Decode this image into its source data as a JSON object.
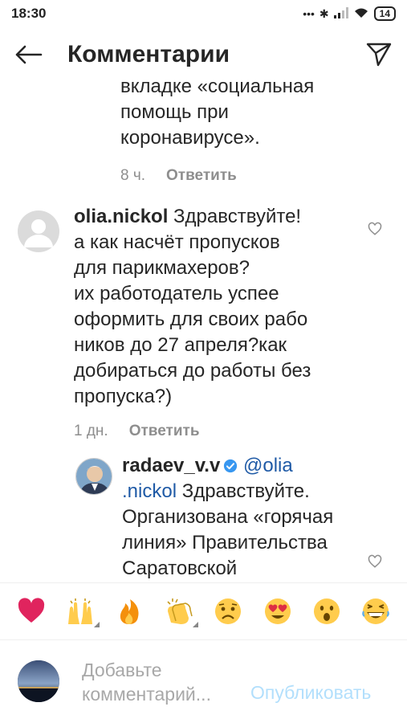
{
  "status_bar": {
    "time": "18:30",
    "battery": "14"
  },
  "header": {
    "title": "Комментарии"
  },
  "comments": {
    "prev": {
      "lines": [
        "вкладке «социальная",
        "помощь при",
        "коронавирусе»."
      ],
      "time": "8 ч.",
      "reply": "Ответить"
    },
    "c2": {
      "username": "olia.nickol",
      "lines": [
        "Здравствуйте!",
        "а как насчёт пропусков",
        "для парикмахеров?",
        "их работодатель успее",
        "оформить для своих рабо",
        "ников до 27 апреля?как",
        "добираться до работы без",
        "пропуска?)"
      ],
      "time": "1 дн.",
      "reply": "Ответить"
    },
    "c3": {
      "username": "radaev_v.v",
      "mention_part1": "@olia",
      "mention_part2": ".nickol",
      "lines": [
        "Здравствуйте.",
        "Организована «горячая",
        "линия» Правительства",
        "Саратовской"
      ]
    }
  },
  "emoji_bar": [
    "heart-emoji",
    "raised-hands-emoji",
    "fire-emoji",
    "clapping-hands-emoji",
    "sad-face-emoji",
    "heart-eyes-emoji",
    "surprised-face-emoji",
    "laughing-face-emoji"
  ],
  "compose": {
    "placeholder_line1": "Добавьте",
    "placeholder_line2": "комментарий...",
    "publish": "Опубликовать"
  },
  "colors": {
    "link": "#1f5aa6",
    "publish": "#b2dffc",
    "meta": "#8e8e8e"
  }
}
